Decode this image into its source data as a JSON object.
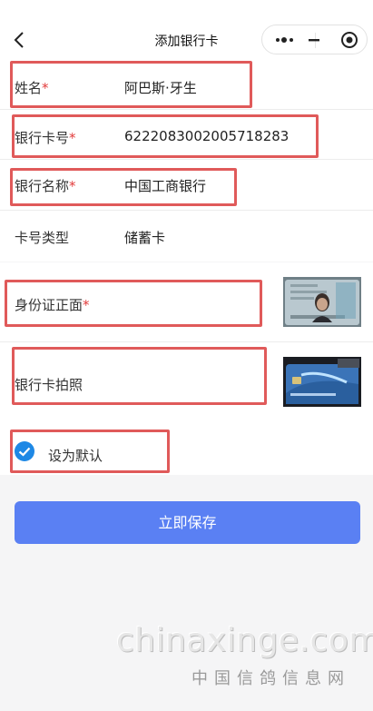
{
  "nav": {
    "title": "添加银行卡",
    "back_icon": "chevron-left-icon",
    "capsule": {
      "more_icon": "more-dots-icon",
      "minimize_icon": "minimize-icon",
      "close_icon": "target-circle-icon"
    }
  },
  "form": {
    "name": {
      "label": "姓名",
      "required_mark": "*",
      "value": "阿巴斯·牙生"
    },
    "card_number": {
      "label": "银行卡号",
      "required_mark": "*",
      "value": "6222083002005718283"
    },
    "bank_name": {
      "label": "银行名称",
      "required_mark": "*",
      "value": "中国工商银行"
    },
    "card_type": {
      "label": "卡号类型",
      "value": "储蓄卡"
    },
    "id_front": {
      "label": "身份证正面",
      "required_mark": "*"
    },
    "card_photo": {
      "label": "银行卡拍照"
    }
  },
  "default_option": {
    "label": "设为默认",
    "checked": true,
    "accent": "#1e88e5"
  },
  "save_button": {
    "label": "立即保存",
    "color": "#5a80f3"
  },
  "highlight_color": "#e05a5a",
  "watermark": {
    "main": "chinaxinge.com",
    "sub": "中国信鸽信息网"
  }
}
